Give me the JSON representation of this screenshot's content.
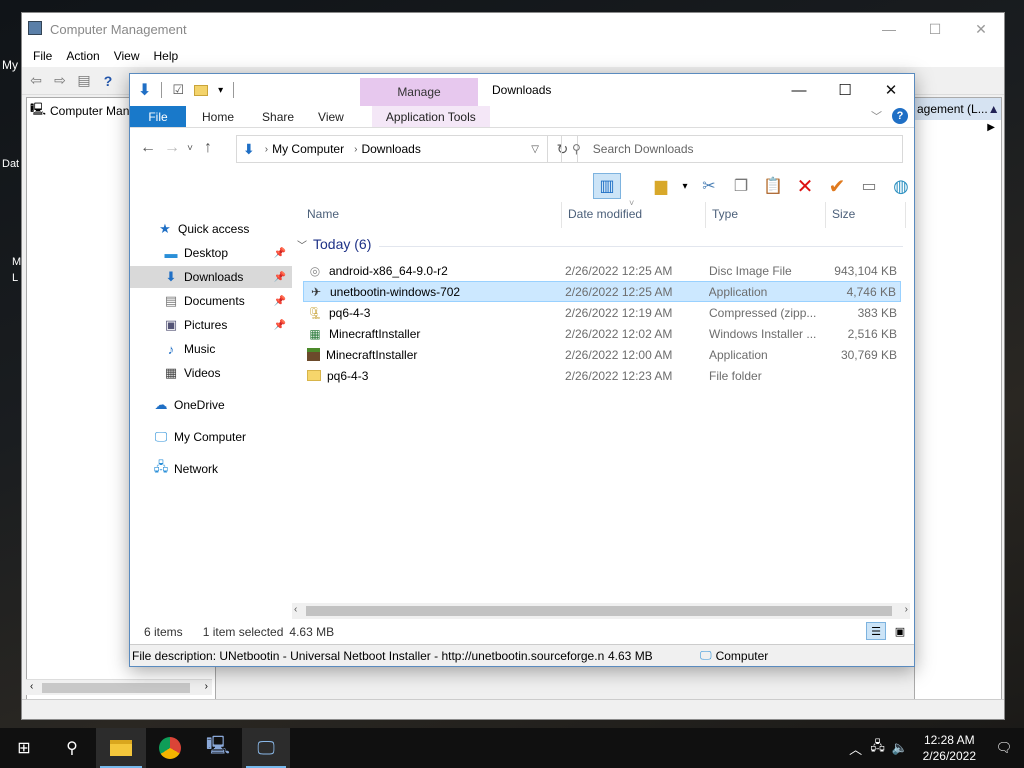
{
  "desktop": {
    "label_my": "My",
    "label_dat": "Dat",
    "label_m": "M",
    "label_l": "L"
  },
  "computer_management": {
    "title": "Computer Management",
    "menu": [
      "File",
      "Action",
      "View",
      "Help"
    ],
    "tree_root": "Computer Management (Local)",
    "right_panel_header": "agement (L...",
    "controls": {
      "minimize": "—",
      "maximize": "☐",
      "close": "✕"
    }
  },
  "explorer": {
    "title": "Downloads",
    "contextual_group": "Manage",
    "ribbon_tabs": {
      "file": "File",
      "home": "Home",
      "share": "Share",
      "view": "View",
      "app_tools": "Application Tools"
    },
    "controls": {
      "minimize": "—",
      "maximize": "☐",
      "close": "✕"
    },
    "address": {
      "root": "My Computer",
      "current": "Downloads"
    },
    "search": {
      "placeholder": "Search Downloads"
    },
    "nav": {
      "quick_access": "Quick access",
      "desktop": "Desktop",
      "downloads": "Downloads",
      "documents": "Documents",
      "pictures": "Pictures",
      "music": "Music",
      "videos": "Videos",
      "onedrive": "OneDrive",
      "my_computer": "My Computer",
      "network": "Network"
    },
    "columns": {
      "name": "Name",
      "date": "Date modified",
      "type": "Type",
      "size": "Size"
    },
    "group": "Today (6)",
    "files": [
      {
        "name": "android-x86_64-9.0-r2",
        "date": "2/26/2022 12:25 AM",
        "type": "Disc Image File",
        "size": "943,104 KB"
      },
      {
        "name": "unetbootin-windows-702",
        "date": "2/26/2022 12:25 AM",
        "type": "Application",
        "size": "4,746 KB"
      },
      {
        "name": "pq6-4-3",
        "date": "2/26/2022 12:19 AM",
        "type": "Compressed (zipp...",
        "size": "383 KB"
      },
      {
        "name": "MinecraftInstaller",
        "date": "2/26/2022 12:02 AM",
        "type": "Windows Installer ...",
        "size": "2,516 KB"
      },
      {
        "name": "MinecraftInstaller",
        "date": "2/26/2022 12:00 AM",
        "type": "Application",
        "size": "30,769 KB"
      },
      {
        "name": "pq6-4-3",
        "date": "2/26/2022 12:23 AM",
        "type": "File folder",
        "size": ""
      }
    ],
    "status": {
      "items": "6 items",
      "selected": "1 item selected",
      "selected_size": "4.63 MB"
    },
    "details_bar": {
      "description": "File description: UNetbootin - Universal Netboot Installer - http://unetbootin.sourceforge.net, Compan",
      "size": "4.63 MB",
      "location": "Computer"
    }
  },
  "taskbar": {
    "time": "12:28 AM",
    "date": "2/26/2022"
  },
  "colors": {
    "accent": "#1979ca",
    "selection": "#cce8ff",
    "manage_tab": "#e7c8ee"
  }
}
